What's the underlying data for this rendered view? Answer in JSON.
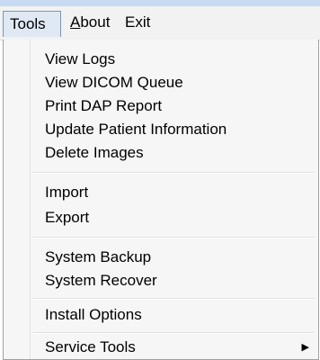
{
  "menubar": {
    "tools_label": "Tools",
    "about_label": "About",
    "exit_label": "Exit"
  },
  "dropdown": {
    "groups": [
      [
        "View Logs",
        "View DICOM Queue",
        "Print DAP Report",
        "Update Patient Information",
        "Delete Images"
      ],
      [
        "Import",
        "Export"
      ],
      [
        "System Backup",
        "System Recover"
      ],
      [
        "Install Options"
      ],
      [
        "Service Tools"
      ]
    ],
    "submenu_icon": "triangle-right-icon"
  }
}
